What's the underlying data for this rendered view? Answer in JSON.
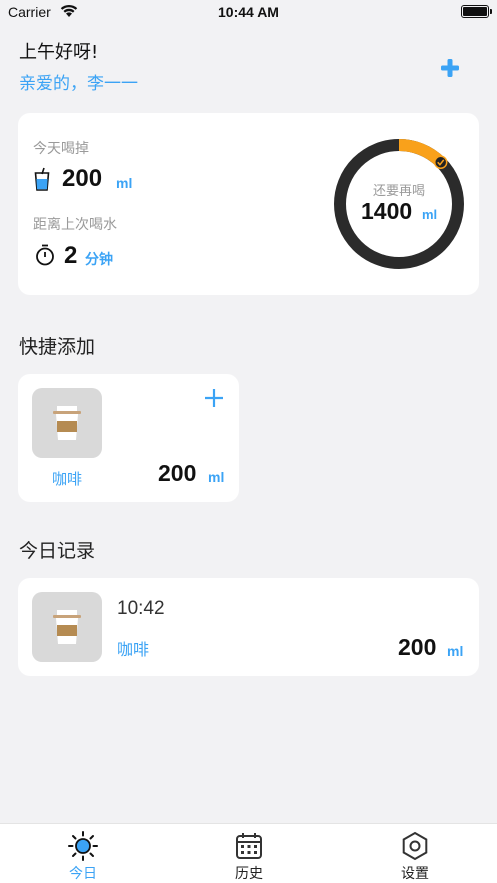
{
  "status_bar": {
    "carrier": "Carrier",
    "time": "10:44 AM"
  },
  "header": {
    "greeting": "上午好呀!",
    "user": "亲爱的，李一一"
  },
  "summary": {
    "today_label": "今天喝掉",
    "today_value": "200",
    "today_unit": "ml",
    "last_label": "距离上次喝水",
    "last_value": "2",
    "last_unit": "分钟",
    "remaining_label": "还要再喝",
    "remaining_value": "1400",
    "remaining_unit": "ml",
    "progress_fraction": 0.125
  },
  "quick_add": {
    "title": "快捷添加",
    "items": [
      {
        "name": "咖啡",
        "amount": "200",
        "unit": "ml"
      }
    ]
  },
  "today_records": {
    "title": "今日记录",
    "items": [
      {
        "time": "10:42",
        "name": "咖啡",
        "amount": "200",
        "unit": "ml"
      }
    ]
  },
  "tabs": [
    {
      "label": "今日",
      "icon": "sun-icon",
      "active": true
    },
    {
      "label": "历史",
      "icon": "calendar-icon",
      "active": false
    },
    {
      "label": "设置",
      "icon": "hexagon-settings-icon",
      "active": false
    }
  ],
  "colors": {
    "accent": "#3ba3f5",
    "progress": "#f9a11b",
    "ring_track": "#2b2b2b",
    "background": "#f2f2f4"
  }
}
